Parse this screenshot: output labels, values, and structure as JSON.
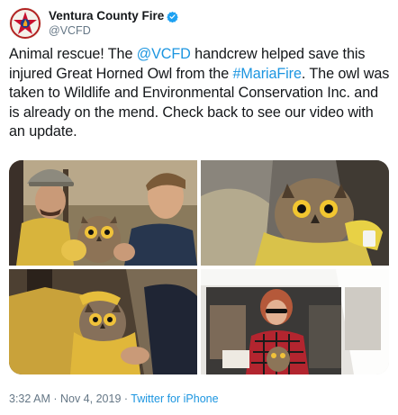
{
  "account": {
    "display_name": "Ventura County Fire",
    "handle": "@VCFD",
    "verified": true,
    "avatar_icon": "fire-department-logo-icon"
  },
  "tweet": {
    "segments": [
      {
        "text": "Animal rescue! The ",
        "link": false
      },
      {
        "text": "@VCFD",
        "link": true
      },
      {
        "text": " handcrew helped save this injured Great Horned Owl from the ",
        "link": false
      },
      {
        "text": "#MariaFire",
        "link": true
      },
      {
        "text": ". The owl was taken to Wildlife and Environmental Conservation Inc. and is already on the mend. Check back to see our video with an update.",
        "link": false
      }
    ]
  },
  "media": {
    "count": 4
  },
  "footer": {
    "time": "3:32 AM",
    "separator1": " · ",
    "date": "Nov 4, 2019",
    "separator2": " · ",
    "app": "Twitter for iPhone"
  },
  "colors": {
    "link": "#1b95e0",
    "secondary_text": "#657786",
    "verified_badge": "#1da1f2"
  }
}
